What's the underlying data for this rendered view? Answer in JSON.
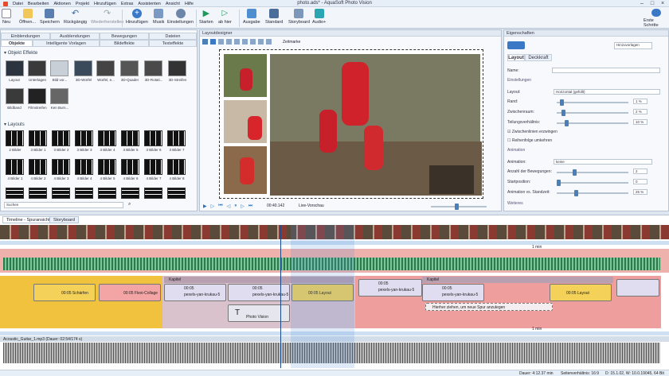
{
  "window": {
    "title": "photo.ads* - AquaSoft Photo Vision"
  },
  "menu": [
    "Datei",
    "Bearbeiten",
    "Aktionen",
    "Projekt",
    "Hinzufügen",
    "Extras",
    "Assistenten",
    "Ansicht",
    "Hilfe"
  ],
  "ribbon": {
    "neu": "Neu",
    "oeffnen": "Öffnen...",
    "speichern": "Speichern",
    "rueckgaengig": "Rückgängig",
    "wiederherstellen": "Wiederherstellen",
    "hinzufuegen": "Hinzufügen",
    "musik": "Musik",
    "einstellungen": "Einstellungen",
    "starten": "Starten",
    "abhier": "ab hier",
    "ausgabe": "Ausgabe",
    "standard": "Standard",
    "storyboard": "Storyboard",
    "audio": "Audio+",
    "erste_schritte": "Erste Schritte"
  },
  "left": {
    "tabs_row1": [
      "Einblendungen",
      "Ausblendungen",
      "Bewegungen",
      "Dateien"
    ],
    "tabs_row2": [
      "Objekte",
      "Intelligente Vorlagen",
      "Bildeffekte",
      "Texteffekte"
    ],
    "effects_header": "Objekt Effekte",
    "effects": [
      "Layout",
      "Unterlagen",
      "Bild vor...",
      "3D-Würfel",
      "Würfel, e...",
      "3D-Quader",
      "3D-Rotati...",
      "3D-Streifen",
      "Bildband",
      "Filmstreifen",
      "Ken Burn..."
    ],
    "layouts_header": "Layouts",
    "layout_labels": [
      "2 Bilder",
      "3 Bilder 1",
      "3 Bilder 2",
      "3 Bilder 3",
      "3 Bilder 4",
      "3 Bilder 5",
      "3 Bilder 6",
      "3 Bilder 7",
      "4 Bilder 1",
      "4 Bilder 2",
      "4 Bilder 3",
      "4 Bilder 4",
      "4 Bilder 5",
      "4 Bilder 6",
      "4 Bilder 7",
      "4 Bilder 8"
    ],
    "search_placeholder": "Suchen"
  },
  "designer": {
    "title": "Layoutdesigner",
    "zeitmarke": "Zeitmarke",
    "time": "00:40.142",
    "live": "Live-Vorschau"
  },
  "props": {
    "title": "Eigenschaften",
    "hinzu": "Hinzuvorlagen",
    "tab_layout": "Layout",
    "tab_deckkraft": "Deckkraft",
    "name_label": "Name:",
    "einstellungen": "Einstellungen",
    "layout_label": "Layout:",
    "layout_value": "Horizontal (gefüllt)",
    "rand_label": "Rand:",
    "rand_value": "1 %",
    "zwischen_label": "Zwischenraum:",
    "zwischen_value": "2 %",
    "teil_label": "Teilungsverhältnis:",
    "teil_value": "10 %",
    "check1": "Zwischenlinien erzwingen",
    "check2": "Reihenfolge umkehren",
    "animation": "Animation",
    "anim_label": "Animation:",
    "anim_value": "keine",
    "anzahl_label": "Anzahl der Bewegungen:",
    "anzahl_value": "2",
    "start_label": "Startposition:",
    "start_value": "0",
    "standzeit_label": "Animation vs. Standzeit:",
    "standzeit_value": "25 %",
    "weiteres": "Weiteres"
  },
  "timeline": {
    "tabs": [
      "Timeline - Spuransicht",
      "Storyboard"
    ],
    "marker": "1 min",
    "clips": {
      "schaerfen": "00:05  Schärfen",
      "collage": "00:05  Flexi-Collage",
      "kapitel1": "Kapitel",
      "kapitel2": "Kapitel",
      "pexels1": "pexels-yan-krukau-5",
      "pexels2": "pexels-yan-krukau-5",
      "pexels3": "pexels-yan-krukau-5",
      "pexels4": "pexels-yan-krukau-5",
      "dur": "00:05",
      "layout1": "00:05  Layout",
      "layout2": "00:05  Layout",
      "photovision": "Photo Vision",
      "hint": "Hierher ziehen, um neue Spur anzulegen"
    },
    "audio": "Acoustic_Guitar_1.mp3 (Dauer: 02:54/174 s)"
  },
  "status": {
    "dauer": "Dauer: 4:12.37 min",
    "ratio": "Seitenverhältnis: 16:9",
    "version": "D: 15.1.02, W: 10.0.19045, 64 Bit"
  }
}
